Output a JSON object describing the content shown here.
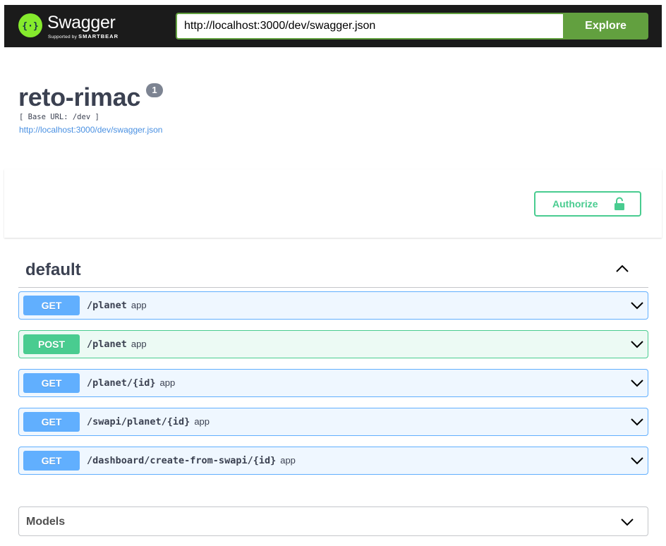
{
  "topbar": {
    "brand": "Swagger",
    "supported_by": "Supported by",
    "smartbear": "SMARTBEAR",
    "url_value": "http://localhost:3000/dev/swagger.json",
    "explore_label": "Explore"
  },
  "info": {
    "title": "reto-rimac",
    "version": "1",
    "base_url": "[ Base URL: /dev ]",
    "spec_link": "http://localhost:3000/dev/swagger.json"
  },
  "scheme": {
    "authorize_label": "Authorize"
  },
  "tag": {
    "name": "default",
    "operations": [
      {
        "method": "GET",
        "path": "/planet",
        "description": "app"
      },
      {
        "method": "POST",
        "path": "/planet",
        "description": "app"
      },
      {
        "method": "GET",
        "path": "/planet/{id}",
        "description": "app"
      },
      {
        "method": "GET",
        "path": "/swapi/planet/{id}",
        "description": "app"
      },
      {
        "method": "GET",
        "path": "/dashboard/create-from-swapi/{id}",
        "description": "app"
      }
    ]
  },
  "models": {
    "title": "Models"
  },
  "colors": {
    "topbar_bg": "#1b1b1b",
    "brand_green": "#85ea2d",
    "explore_green": "#62a03f",
    "get_blue": "#61affe",
    "post_green": "#49cc90",
    "text": "#3b4151",
    "link": "#4990e2"
  },
  "icons": [
    "swagger-logo-icon",
    "lock-icon",
    "chevron-up-icon",
    "chevron-down-icon"
  ]
}
